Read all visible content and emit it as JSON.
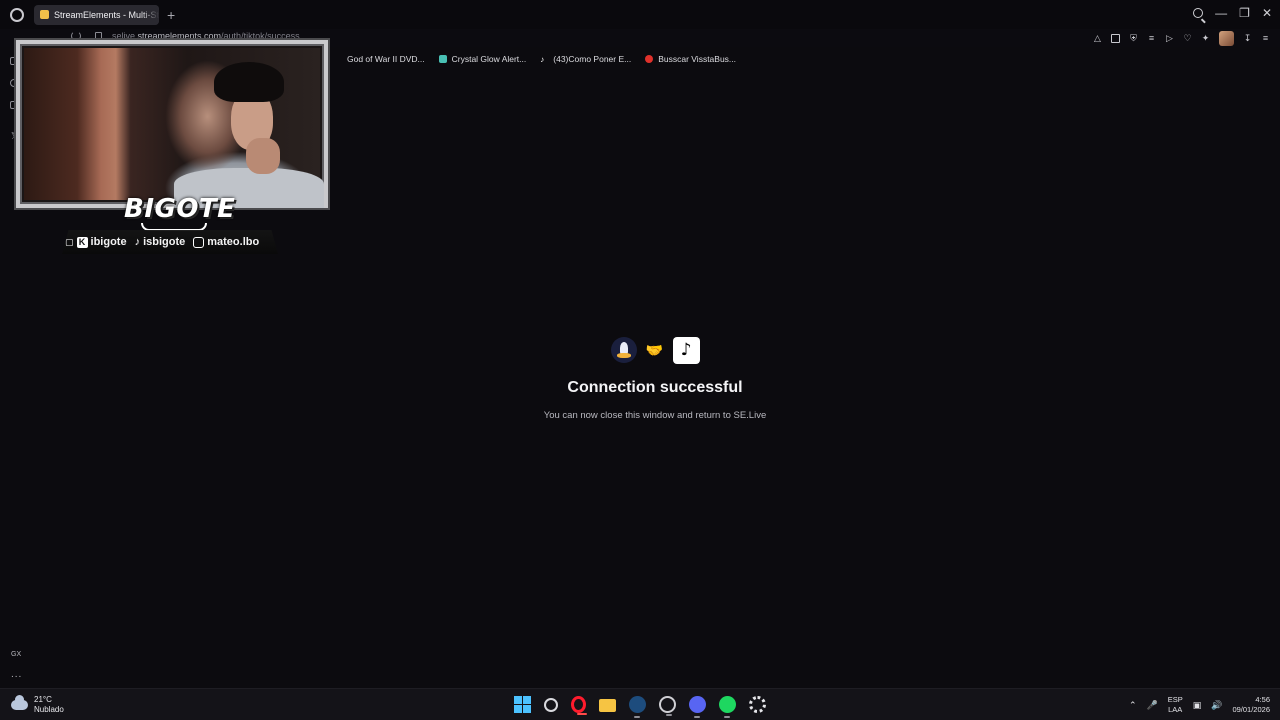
{
  "browser": {
    "tab_title": "StreamElements - Multi-Stream",
    "new_tab": "+",
    "url_prefix": "selive.",
    "url_domain": "streamelements.com",
    "url_path": "/auth/tiktok/success",
    "bookmarks": [
      {
        "label": "God of War II DVD...",
        "color": "#3a3a40"
      },
      {
        "label": "Crystal Glow Alert...",
        "color": "#49c0b4"
      },
      {
        "label": "(43)Como Poner E...",
        "color": "#ffffff"
      },
      {
        "label": "Busscar VisstaBus...",
        "color": "#e0312b"
      }
    ],
    "sidebar_labels": {
      "gx": "GX",
      "more": "..."
    }
  },
  "overlay": {
    "brand": "BIGOTE",
    "socials": [
      {
        "platform": "twitch-kick",
        "handle": "ibigote"
      },
      {
        "platform": "tiktok",
        "handle": "isbigote"
      },
      {
        "platform": "instagram",
        "handle": "mateo.lbo"
      }
    ]
  },
  "main": {
    "headline": "Connection successful",
    "message": "You can now close this window and return to SE.Live",
    "icons": [
      "streamelements-icon",
      "handshake-icon",
      "tiktok-icon"
    ]
  },
  "taskbar": {
    "weather_temp": "21°C",
    "weather_desc": "Nublado",
    "lang_top": "ESP",
    "lang_bottom": "LAA",
    "time": "4:56",
    "date": "09/01/2026"
  }
}
